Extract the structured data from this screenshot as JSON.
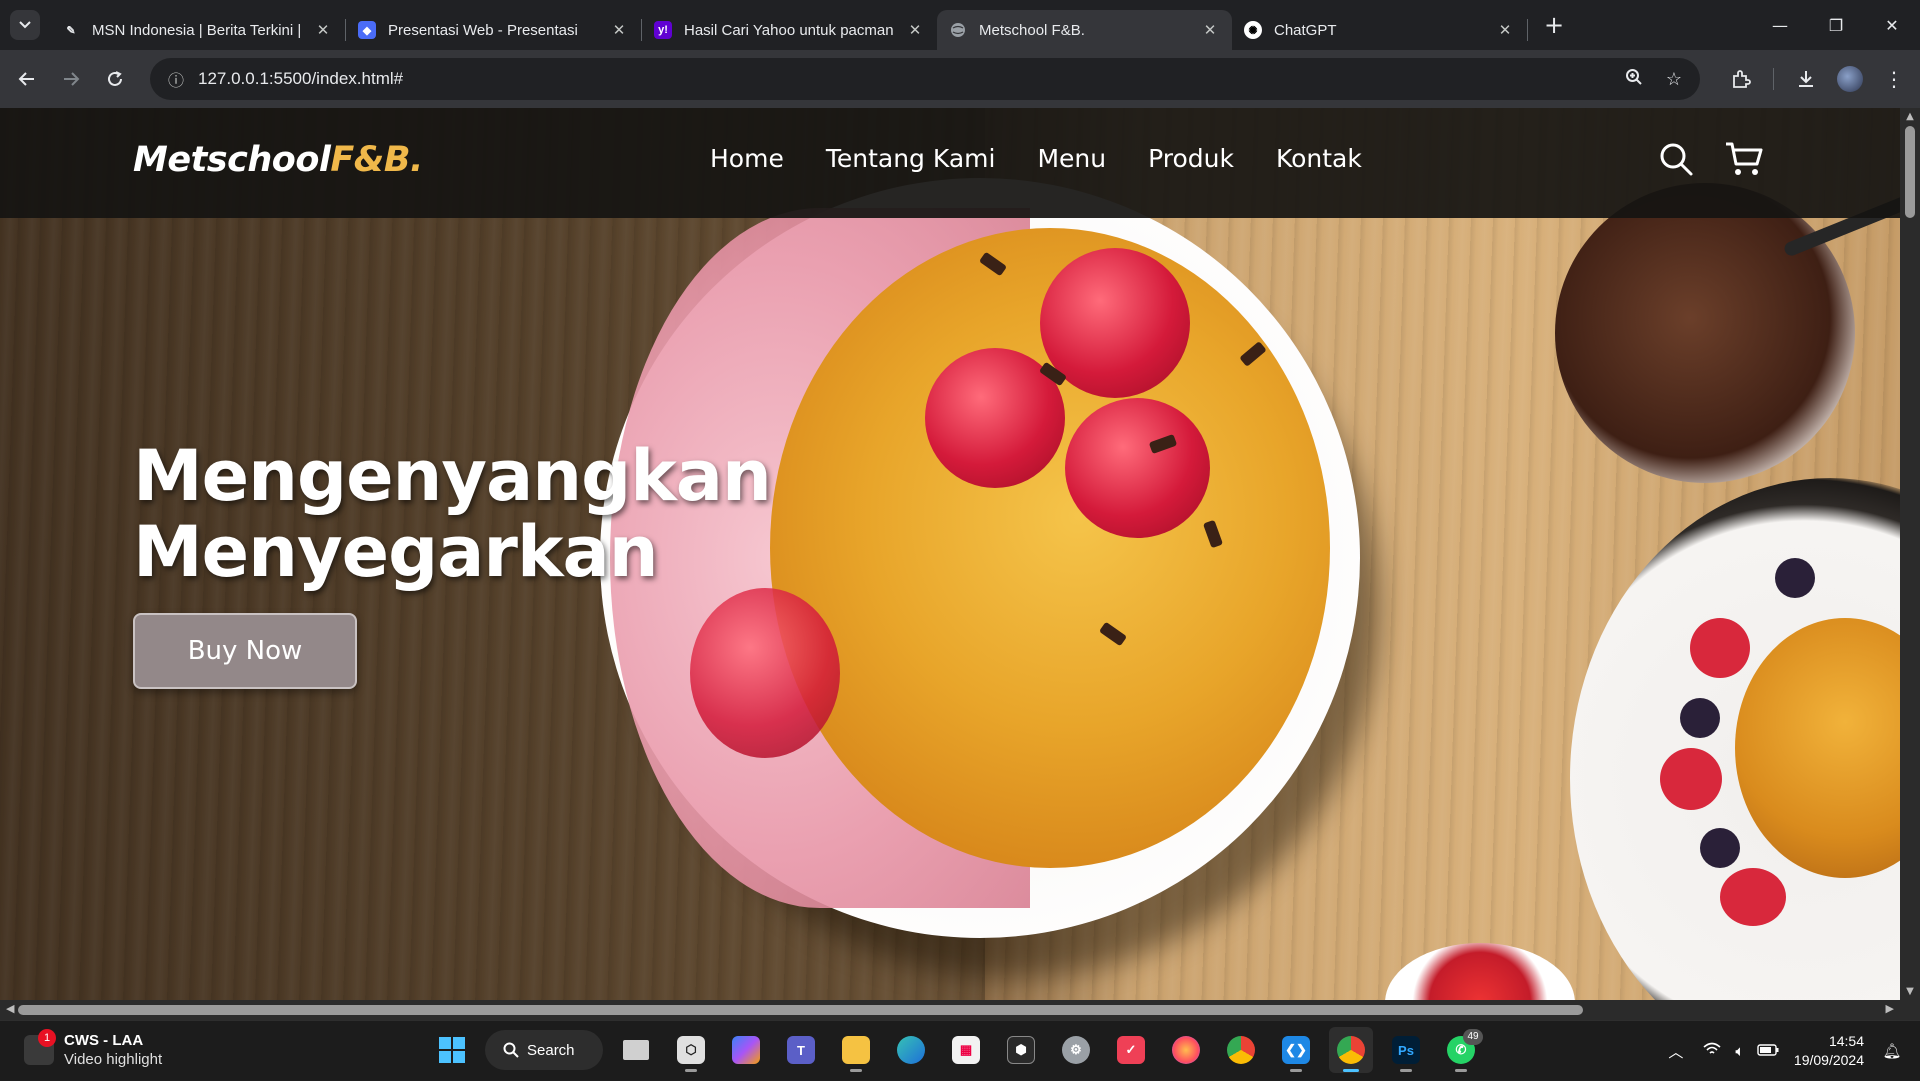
{
  "browser": {
    "tabs": [
      {
        "title": "MSN Indonesia | Berita Terkini |",
        "icon": "msn-icon",
        "active": false
      },
      {
        "title": "Presentasi Web - Presentasi",
        "icon": "presentation-icon",
        "active": false
      },
      {
        "title": "Hasil Cari Yahoo untuk pacman",
        "icon": "yahoo-icon",
        "active": false
      },
      {
        "title": "Metschool F&B.",
        "icon": "globe-icon",
        "active": true
      },
      {
        "title": "ChatGPT",
        "icon": "chatgpt-icon",
        "active": false
      }
    ],
    "new_tab_label": "+",
    "url": "127.0.0.1:5500/index.html#",
    "colors": {
      "chrome_bg": "#202124",
      "toolbar_bg": "#35363a"
    }
  },
  "site": {
    "logo": {
      "main": "Metschool",
      "accent": "F&B.",
      "accent_color": "#f0b84a"
    },
    "nav": [
      "Home",
      "Tentang Kami",
      "Menu",
      "Produk",
      "Kontak"
    ],
    "icons": [
      "search-icon",
      "cart-icon"
    ],
    "hero": {
      "title_line1": "Mengenyangkan",
      "title_line2": "Menyegarkan",
      "cta": "Buy Now"
    }
  },
  "taskbar": {
    "notification": {
      "badge": "1",
      "title": "CWS - LAA",
      "subtitle": "Video highlight"
    },
    "search_label": "Search",
    "apps": [
      {
        "name": "start",
        "label": ""
      },
      {
        "name": "task-view",
        "label": ""
      },
      {
        "name": "unity",
        "label": ""
      },
      {
        "name": "copilot",
        "label": ""
      },
      {
        "name": "teams",
        "label": ""
      },
      {
        "name": "file-explorer",
        "label": ""
      },
      {
        "name": "edge",
        "label": ""
      },
      {
        "name": "store",
        "label": ""
      },
      {
        "name": "unity-hub",
        "label": ""
      },
      {
        "name": "settings",
        "label": ""
      },
      {
        "name": "pocket",
        "label": ""
      },
      {
        "name": "firefox",
        "label": ""
      },
      {
        "name": "chrome",
        "label": ""
      },
      {
        "name": "vscode",
        "label": ""
      },
      {
        "name": "chrome-profile",
        "label": ""
      },
      {
        "name": "photoshop",
        "label": "Ps"
      },
      {
        "name": "whatsapp",
        "label": "",
        "badge": "49"
      }
    ],
    "time": "14:54",
    "date": "19/09/2024"
  }
}
